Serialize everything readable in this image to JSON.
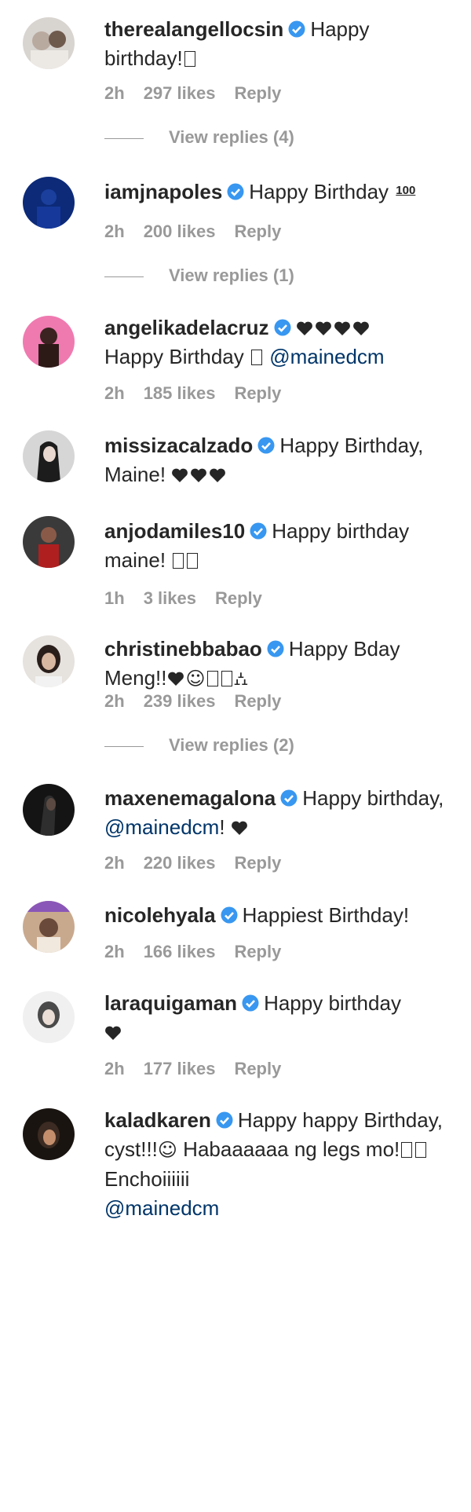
{
  "colors": {
    "text": "#262626",
    "meta": "#999999",
    "mention": "#003569",
    "verified": "#3897f0"
  },
  "comments": [
    {
      "username": "therealangellocsin",
      "text": "Happy birthday!",
      "emoji": "□",
      "time": "2h",
      "likes": "297 likes",
      "reply": "Reply",
      "view_replies": "View replies (4)"
    },
    {
      "username": "iamjnapoles",
      "text": "Happy Birthday",
      "emoji": "100",
      "time": "2h",
      "likes": "200 likes",
      "reply": "Reply",
      "view_replies": "View replies (1)"
    },
    {
      "username": "angelikadelacruz",
      "text": "Happy Birthday",
      "mention": "@mainedcm",
      "time": "2h",
      "likes": "185 likes",
      "reply": "Reply"
    },
    {
      "username": "missizacalzado",
      "text": "Happy Birthday, Maine!",
      "time": "",
      "likes": "",
      "reply": ""
    },
    {
      "username": "anjodamiles10",
      "text": "Happy birthday maine!",
      "time": "1h",
      "likes": "3 likes",
      "reply": "Reply"
    },
    {
      "username": "christinebbabao",
      "text": "Happy Bday Meng!!",
      "time": "2h",
      "likes": "239 likes",
      "reply": "Reply",
      "view_replies": "View replies (2)"
    },
    {
      "username": "maxenemagalona",
      "text": "Happy birthday,",
      "mention": "@mainedcm",
      "suffix": "!",
      "time": "2h",
      "likes": "220 likes",
      "reply": "Reply"
    },
    {
      "username": "nicolehyala",
      "text": "Happiest Birthday!",
      "time": "2h",
      "likes": "166 likes",
      "reply": "Reply"
    },
    {
      "username": "laraquigaman",
      "text": "Happy birthday",
      "time": "2h",
      "likes": "177 likes",
      "reply": "Reply"
    },
    {
      "username": "kaladkaren",
      "text": "Happy happy Birthday, cyst!!!",
      "text2": "Habaaaaaa ng legs mo!",
      "text3": "Enchoiiiiii",
      "mention": "@mainedcm"
    }
  ]
}
